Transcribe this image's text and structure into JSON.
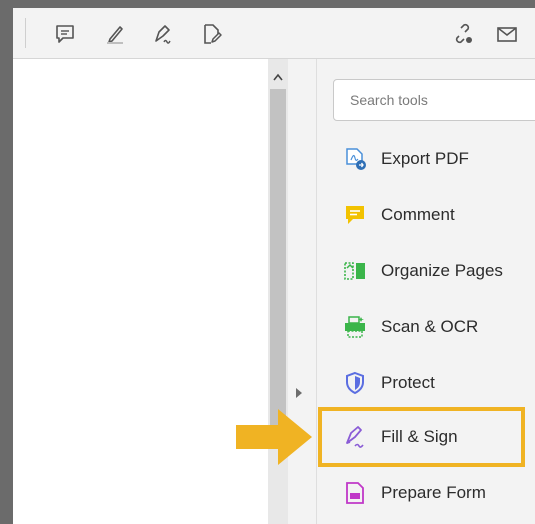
{
  "toolbar": {
    "icons": [
      "comment-icon",
      "highlight-pen-icon",
      "sign-pen-icon",
      "edit-tag-icon",
      "share-link-icon",
      "email-icon"
    ]
  },
  "search": {
    "placeholder": "Search tools"
  },
  "tools": [
    {
      "label": "Export PDF",
      "icon": "export-pdf-icon",
      "color": "#4a90d9"
    },
    {
      "label": "Comment",
      "icon": "comment-tool-icon",
      "color": "#f2c200"
    },
    {
      "label": "Organize Pages",
      "icon": "organize-pages-icon",
      "color": "#3bb54a"
    },
    {
      "label": "Scan & OCR",
      "icon": "scan-ocr-icon",
      "color": "#3bb54a"
    },
    {
      "label": "Protect",
      "icon": "protect-shield-icon",
      "color": "#5b6ee1"
    },
    {
      "label": "Fill & Sign",
      "icon": "fill-sign-icon",
      "color": "#8a5cd6"
    },
    {
      "label": "Prepare Form",
      "icon": "prepare-form-icon",
      "color": "#c038c8"
    }
  ],
  "highlight": {
    "color": "#f0b323",
    "target": "Fill & Sign"
  }
}
